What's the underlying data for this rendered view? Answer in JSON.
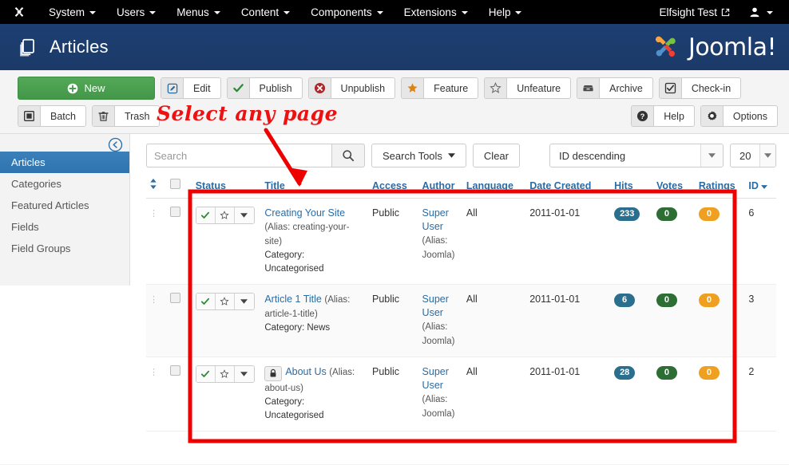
{
  "topbar": {
    "logo_icon": "joomla-mark-icon",
    "menu": [
      {
        "label": "System",
        "icon": "chevron-down-icon"
      },
      {
        "label": "Users",
        "icon": "chevron-down-icon"
      },
      {
        "label": "Menus",
        "icon": "chevron-down-icon"
      },
      {
        "label": "Content",
        "icon": "chevron-down-icon"
      },
      {
        "label": "Components",
        "icon": "chevron-down-icon"
      },
      {
        "label": "Extensions",
        "icon": "chevron-down-icon"
      },
      {
        "label": "Help",
        "icon": "chevron-down-icon"
      }
    ],
    "site_name": "Elfsight Test",
    "site_link_icon": "external-link-icon",
    "user_icon": "user-icon",
    "user_caret_icon": "chevron-down-icon"
  },
  "header": {
    "title": "Articles",
    "title_icon": "copy-pages-icon",
    "brand": "Joomla!",
    "brand_icon": "joomla-logo-icon",
    "bg_color": "#1c3d6e"
  },
  "toolbar": {
    "row1": [
      {
        "label": "New",
        "icon": "plus-circle-icon",
        "style": "primary"
      },
      {
        "label": "Edit",
        "icon": "pencil-square-icon"
      },
      {
        "label": "Publish",
        "icon": "check-icon"
      },
      {
        "label": "Unpublish",
        "icon": "x-circle-icon"
      },
      {
        "label": "Feature",
        "icon": "star-filled-icon"
      },
      {
        "label": "Unfeature",
        "icon": "star-outline-icon"
      },
      {
        "label": "Archive",
        "icon": "archive-box-icon"
      },
      {
        "label": "Check-in",
        "icon": "checkbox-icon"
      }
    ],
    "row2_left": [
      {
        "label": "Batch",
        "icon": "batch-square-icon"
      },
      {
        "label": "Trash",
        "icon": "trash-icon"
      }
    ],
    "row2_right": [
      {
        "label": "Help",
        "icon": "question-circle-icon"
      },
      {
        "label": "Options",
        "icon": "gear-icon"
      }
    ]
  },
  "annotation": {
    "text": "Select any page",
    "color": "#ee1111"
  },
  "sidebar": {
    "collapse_icon": "arrow-left-circle-icon",
    "items": [
      {
        "label": "Articles",
        "active": true
      },
      {
        "label": "Categories",
        "active": false
      },
      {
        "label": "Featured Articles",
        "active": false
      },
      {
        "label": "Fields",
        "active": false
      },
      {
        "label": "Field Groups",
        "active": false
      }
    ]
  },
  "filterbar": {
    "search_placeholder": "Search",
    "search_value": "",
    "search_icon": "magnifier-icon",
    "search_tools_label": "Search Tools",
    "search_tools_icon": "chevron-down-icon",
    "clear_label": "Clear",
    "sort_value": "ID descending",
    "limit_value": "20"
  },
  "table": {
    "headers": {
      "drag": "",
      "check": "",
      "status": "Status",
      "title": "Title",
      "access": "Access",
      "author": "Author",
      "language": "Language",
      "date": "Date Created",
      "hits": "Hits",
      "votes": "Votes",
      "ratings": "Ratings",
      "id": "ID"
    },
    "sort_indicator_icon": "caret-down-icon",
    "ordering_icon": "sort-updown-icon",
    "rows": [
      {
        "title": "Creating Your Site",
        "alias": "(Alias: creating-your-site)",
        "category": "Category: Uncategorised",
        "locked": false,
        "access": "Public",
        "author": "Super User",
        "author_alias": "(Alias: Joomla)",
        "language": "All",
        "date": "2011-01-01",
        "hits": "233",
        "votes": "0",
        "ratings": "0",
        "id": "6"
      },
      {
        "title": "Article 1 Title",
        "alias": "(Alias: article-1-title)",
        "category": "Category: News",
        "locked": false,
        "access": "Public",
        "author": "Super User",
        "author_alias": "(Alias: Joomla)",
        "language": "All",
        "date": "2011-01-01",
        "hits": "6",
        "votes": "0",
        "ratings": "0",
        "id": "3"
      },
      {
        "title": "About Us",
        "alias": "(Alias: about-us)",
        "category": "Category: Uncategorised",
        "locked": true,
        "lock_icon": "lock-icon",
        "access": "Public",
        "author": "Super User",
        "author_alias": "(Alias: Joomla)",
        "language": "All",
        "date": "2011-01-01",
        "hits": "28",
        "votes": "0",
        "ratings": "0",
        "id": "2"
      }
    ]
  }
}
